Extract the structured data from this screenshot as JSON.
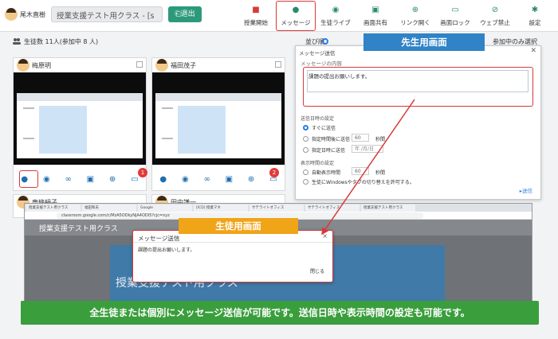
{
  "header": {
    "teacher_name": "尾木直樹",
    "class_select": "授業支援テスト用クラス - [s",
    "exit_label": "退出",
    "tools": [
      {
        "label": "授業開始",
        "icon": "stop-square-icon",
        "glyph": "■"
      },
      {
        "label": "メッセージ",
        "icon": "chat-bubble-icon",
        "glyph": "●"
      },
      {
        "label": "生徒ライブ",
        "icon": "eye-icon",
        "glyph": "◉"
      },
      {
        "label": "画面共有",
        "icon": "monitor-share-icon",
        "glyph": "▣"
      },
      {
        "label": "リンク開く",
        "icon": "globe-link-icon",
        "glyph": "⊕"
      },
      {
        "label": "画面ロック",
        "icon": "monitor-lock-icon",
        "glyph": "▭"
      },
      {
        "label": "ウェブ禁止",
        "icon": "globe-block-icon",
        "glyph": "⊘"
      },
      {
        "label": "設定",
        "icon": "gear-icon",
        "glyph": "✱"
      }
    ]
  },
  "subbar": {
    "student_count": "生徒数  11人(参加中 8 人)",
    "sort_label": "並び順",
    "join_filter": "参加中のみ選択"
  },
  "students": [
    {
      "name": "梅原明",
      "badge": ""
    },
    {
      "name": "福田茂子",
      "badge": "2"
    },
    {
      "name": "東條絹子",
      "badge": ""
    },
    {
      "name": "田中謙一",
      "badge": ""
    }
  ],
  "student_card_badges": {
    "first": "1",
    "second": "2"
  },
  "teacher_dialog": {
    "title": "メッセージ送信",
    "message_label": "メッセージの内容",
    "message_value": "課題の提出お願いします。",
    "send_time_label": "送信日時の設定",
    "opt_now": "すぐに送信",
    "opt_after": "指定時間後に送信",
    "after_value": "60",
    "after_unit": "秒間",
    "opt_at": "指定日時に送信",
    "date_placeholder": "年 /月/日",
    "display_label": "表示時間の設定",
    "opt_auto": "自動表示時間",
    "auto_value": "60",
    "auto_unit": "秒間",
    "opt_windows": "生徒にWindowsやタブの切り替えを許可する。",
    "send_label": "送信",
    "banner": "先生用画面"
  },
  "student_window": {
    "tabs": [
      "授業支援テスト用クラス",
      "福田和夫",
      "Google",
      "[ICD] 授業マネ",
      "サテライトオフィス",
      "サテライトオフィス",
      "授業支援テスト用クラス"
    ],
    "address": "classroom.google.com/c/MzA5ODkyNjA4ODI5?cjc=xyz",
    "class_name": "授業支援テスト用クラス",
    "banner_title": "授業支援テスト用クラス",
    "dialog_title": "メッセージ送信",
    "dialog_body": "課題の提出お願いします。",
    "close_label": "閉じる",
    "banner": "生徒用画面"
  },
  "caption": "全生徒または個別にメッセージ送信が可能です。送信日時や表示時間の設定も可能です。",
  "colors": {
    "accent_green": "#2c9a7a",
    "teacher_banner": "#2f83c6",
    "student_banner": "#f0a418",
    "caption_bg": "#3a9e3d",
    "highlight_red": "#d63a3a"
  }
}
